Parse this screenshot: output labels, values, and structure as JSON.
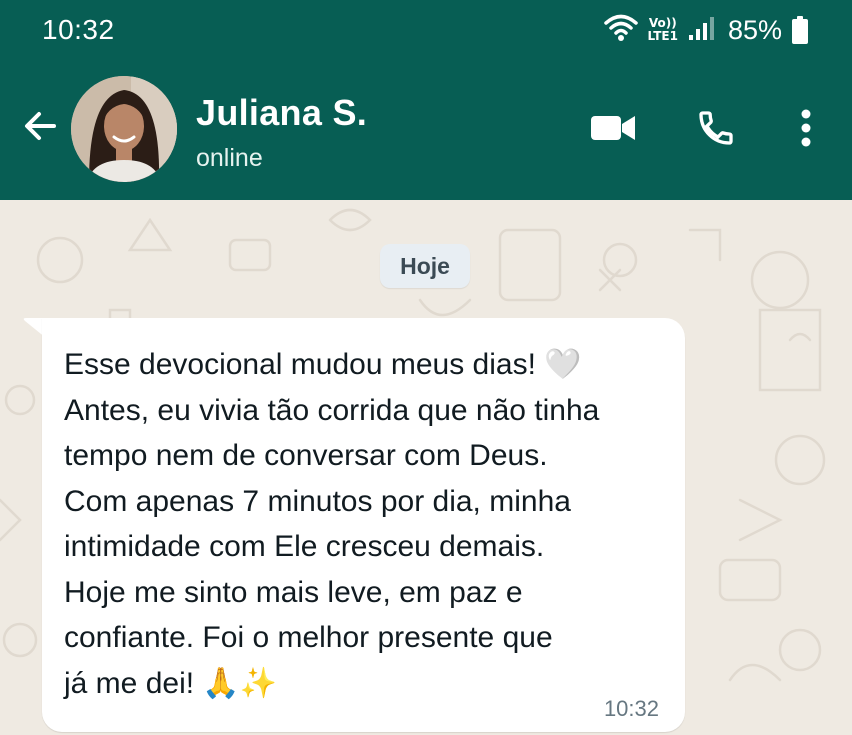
{
  "status_bar": {
    "time": "10:32",
    "volte_top": "Vo))",
    "volte_bottom": "LTE1",
    "battery_percent": "85%",
    "icons": [
      "wifi-icon",
      "signal-icon",
      "battery-icon"
    ]
  },
  "header": {
    "back_icon": "arrow-left-icon",
    "contact_name": "Juliana S.",
    "contact_status": "online",
    "actions": [
      "video-call-icon",
      "voice-call-icon",
      "more-vert-icon"
    ]
  },
  "chat": {
    "date_chip": "Hoje",
    "message": {
      "text": "Esse devocional mudou meus dias! 🤍\nAntes, eu vivia tão corrida que não tinha\ntempo nem de conversar com Deus.\nCom apenas 7 minutos por dia, minha\nintimidade com Ele cresceu demais.\nHoje me sinto mais leve, em paz e\nconfiante. Foi o melhor presente que\njá me dei! 🙏✨",
      "time": "10:32"
    }
  },
  "colors": {
    "header_bg": "#075e54",
    "chat_bg": "#efeae2",
    "bubble_bg": "#ffffff",
    "date_chip_bg": "#e8eef3"
  }
}
